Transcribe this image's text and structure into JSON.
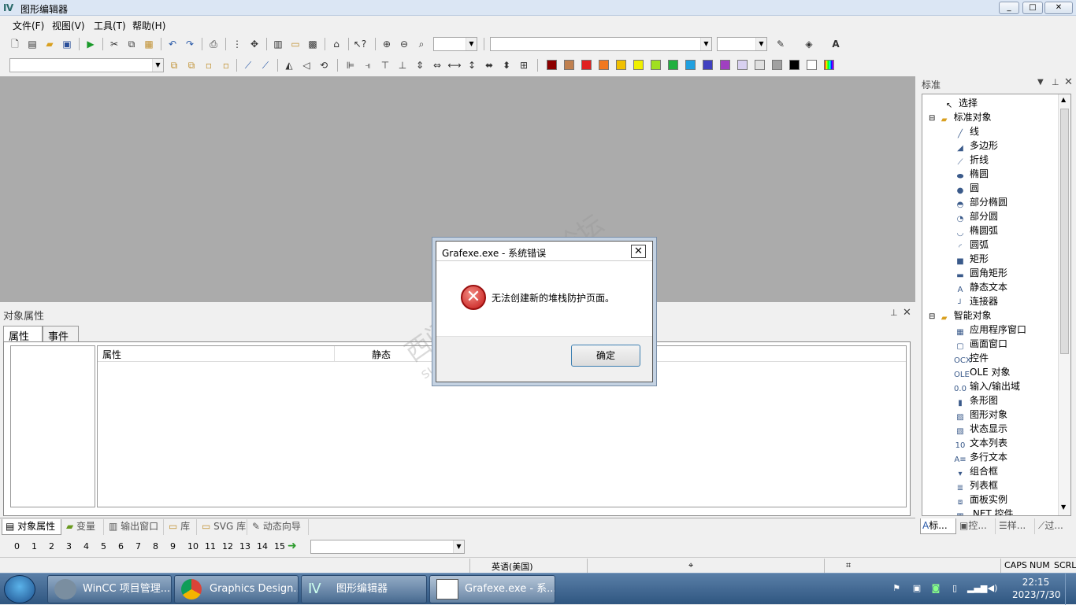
{
  "window": {
    "title": "图形编辑器"
  },
  "menu": [
    "文件(F)",
    "视图(V)",
    "工具(T)",
    "帮助(H)"
  ],
  "colors": {
    "swatches": [
      "#8b0000",
      "#c0804f",
      "#e02020",
      "#f07820",
      "#f0c000",
      "#f0f000",
      "#a0e020",
      "#20b040",
      "#20a0e0",
      "#4040c0",
      "#a040c0",
      "#d8d0f0",
      "#e0e0e0",
      "#a0a0a0",
      "#000000",
      "#ffffff"
    ]
  },
  "properties": {
    "title": "对象属性",
    "tabs": [
      "属性",
      "事件"
    ],
    "col_property": "属性",
    "col_static": "静态"
  },
  "bottom_tabs": [
    "对象属性",
    "变量",
    "输出窗口",
    "库",
    "SVG 库",
    "动态向导"
  ],
  "layers": [
    "0",
    "1",
    "2",
    "3",
    "4",
    "5",
    "6",
    "7",
    "8",
    "9",
    "10",
    "11",
    "12",
    "13",
    "14",
    "15"
  ],
  "status": {
    "lang": "英语(美国)",
    "caps": "CAPS",
    "num": "NUM",
    "scrl": "SCRL"
  },
  "palette": {
    "title": "标准",
    "items": [
      {
        "label": "选择",
        "icon": "cursor-icon",
        "level": 0
      },
      {
        "label": "标准对象",
        "icon": "folder-icon",
        "level": 0
      },
      {
        "label": "线",
        "icon": "line-icon",
        "level": 1
      },
      {
        "label": "多边形",
        "icon": "polygon-icon",
        "level": 1
      },
      {
        "label": "折线",
        "icon": "polyline-icon",
        "level": 1
      },
      {
        "label": "椭圆",
        "icon": "ellipse-icon",
        "level": 1
      },
      {
        "label": "圆",
        "icon": "circle-icon",
        "level": 1
      },
      {
        "label": "部分椭圆",
        "icon": "ellipse-segment-icon",
        "level": 1
      },
      {
        "label": "部分圆",
        "icon": "pie-segment-icon",
        "level": 1
      },
      {
        "label": "椭圆弧",
        "icon": "ellipse-arc-icon",
        "level": 1
      },
      {
        "label": "圆弧",
        "icon": "circle-arc-icon",
        "level": 1
      },
      {
        "label": "矩形",
        "icon": "rectangle-icon",
        "level": 1
      },
      {
        "label": "圆角矩形",
        "icon": "rounded-rect-icon",
        "level": 1
      },
      {
        "label": "静态文本",
        "icon": "static-text-icon",
        "level": 1
      },
      {
        "label": "连接器",
        "icon": "connector-icon",
        "level": 1
      },
      {
        "label": "智能对象",
        "icon": "folder-icon",
        "level": 0
      },
      {
        "label": "应用程序窗口",
        "icon": "app-window-icon",
        "level": 1
      },
      {
        "label": "画面窗口",
        "icon": "picture-window-icon",
        "level": 1
      },
      {
        "label": "控件",
        "icon": "ocx-icon",
        "level": 1
      },
      {
        "label": "OLE 对象",
        "icon": "ole-icon",
        "level": 1
      },
      {
        "label": "输入/输出域",
        "icon": "io-field-icon",
        "level": 1
      },
      {
        "label": "条形图",
        "icon": "bar-icon",
        "level": 1
      },
      {
        "label": "图形对象",
        "icon": "graphic-object-icon",
        "level": 1
      },
      {
        "label": "状态显示",
        "icon": "status-display-icon",
        "level": 1
      },
      {
        "label": "文本列表",
        "icon": "text-list-icon",
        "level": 1
      },
      {
        "label": "多行文本",
        "icon": "multiline-text-icon",
        "level": 1
      },
      {
        "label": "组合框",
        "icon": "combobox-icon",
        "level": 1
      },
      {
        "label": "列表框",
        "icon": "listbox-icon",
        "level": 1
      },
      {
        "label": "面板实例",
        "icon": "faceplate-icon",
        "level": 1
      },
      {
        "label": ".NET 控件",
        "icon": "dotnet-icon",
        "level": 1
      }
    ],
    "tabs": [
      "标...",
      "控...",
      "样...",
      "过..."
    ]
  },
  "taskbar": {
    "items": [
      "WinCC 项目管理...",
      "Graphics Design...",
      "图形编辑器",
      "Grafexe.exe - 系..."
    ],
    "time": "22:15",
    "date": "2023/7/30"
  },
  "dialog": {
    "title": "Grafexe.exe - 系统错误",
    "message": "无法创建新的堆栈防护页面。",
    "ok": "确定"
  },
  "watermark": {
    "line1": "西门子工业 技术论坛",
    "line2": "support.industry.siemens.com/cs"
  }
}
